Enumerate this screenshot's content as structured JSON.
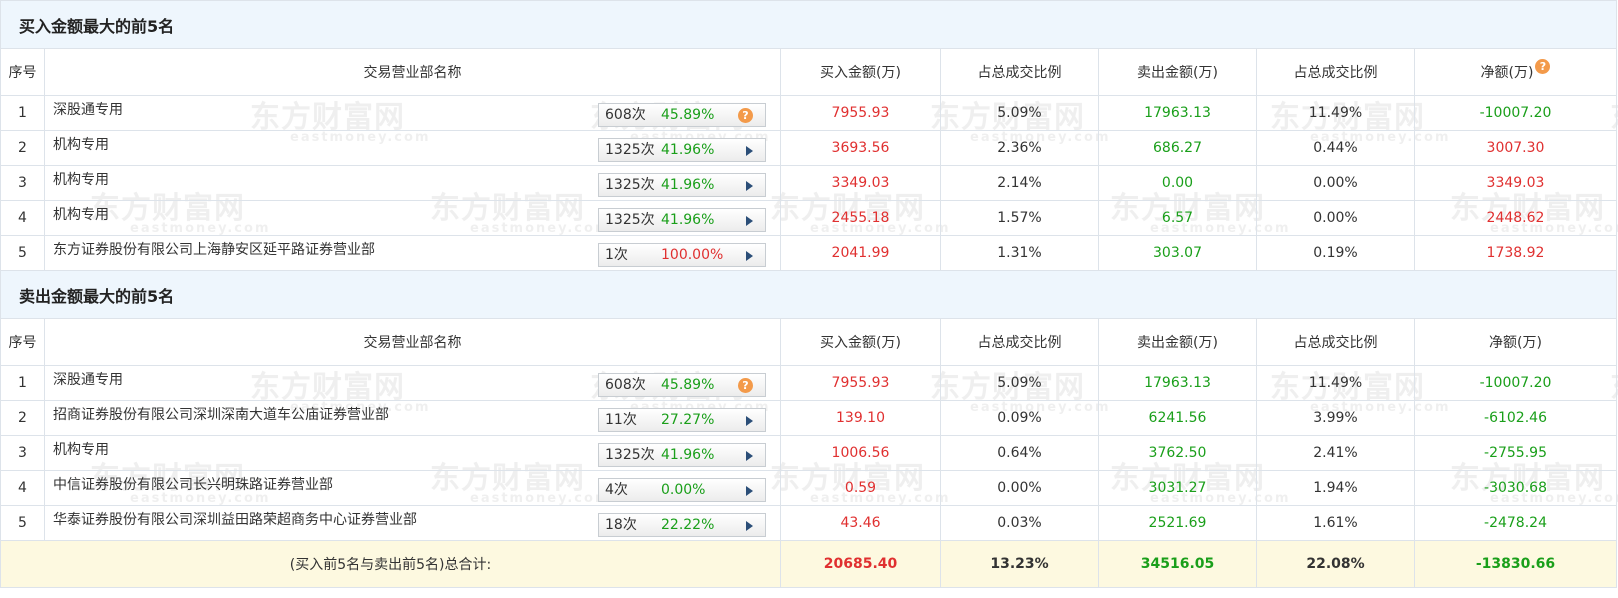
{
  "buy_section": {
    "title": "买入金额最大的前5名",
    "rows": [
      {
        "rank": "1",
        "name": "深股通专用",
        "count": "608次",
        "pct": "45.89%",
        "pct_color": "green",
        "button": "help",
        "buy": "7955.93",
        "buy_ratio": "5.09%",
        "sell": "17963.13",
        "sell_ratio": "11.49%",
        "net": "-10007.20",
        "net_color": "green"
      },
      {
        "rank": "2",
        "name": "机构专用",
        "count": "1325次",
        "pct": "41.96%",
        "pct_color": "green",
        "button": "arrow",
        "buy": "3693.56",
        "buy_ratio": "2.36%",
        "sell": "686.27",
        "sell_ratio": "0.44%",
        "net": "3007.30",
        "net_color": "red"
      },
      {
        "rank": "3",
        "name": "机构专用",
        "count": "1325次",
        "pct": "41.96%",
        "pct_color": "green",
        "button": "arrow",
        "buy": "3349.03",
        "buy_ratio": "2.14%",
        "sell": "0.00",
        "sell_ratio": "0.00%",
        "net": "3349.03",
        "net_color": "red"
      },
      {
        "rank": "4",
        "name": "机构专用",
        "count": "1325次",
        "pct": "41.96%",
        "pct_color": "green",
        "button": "arrow",
        "buy": "2455.18",
        "buy_ratio": "1.57%",
        "sell": "6.57",
        "sell_ratio": "0.00%",
        "net": "2448.62",
        "net_color": "red"
      },
      {
        "rank": "5",
        "name": "东方证券股份有限公司上海静安区延平路证券营业部",
        "count": "1次",
        "pct": "100.00%",
        "pct_color": "red",
        "button": "arrow",
        "buy": "2041.99",
        "buy_ratio": "1.31%",
        "sell": "303.07",
        "sell_ratio": "0.19%",
        "net": "1738.92",
        "net_color": "red"
      }
    ]
  },
  "sell_section": {
    "title": "卖出金额最大的前5名",
    "rows": [
      {
        "rank": "1",
        "name": "深股通专用",
        "count": "608次",
        "pct": "45.89%",
        "pct_color": "green",
        "button": "help",
        "buy": "7955.93",
        "buy_ratio": "5.09%",
        "sell": "17963.13",
        "sell_ratio": "11.49%",
        "net": "-10007.20",
        "net_color": "green"
      },
      {
        "rank": "2",
        "name": "招商证券股份有限公司深圳深南大道车公庙证券营业部",
        "count": "11次",
        "pct": "27.27%",
        "pct_color": "green",
        "button": "arrow",
        "buy": "139.10",
        "buy_ratio": "0.09%",
        "sell": "6241.56",
        "sell_ratio": "3.99%",
        "net": "-6102.46",
        "net_color": "green"
      },
      {
        "rank": "3",
        "name": "机构专用",
        "count": "1325次",
        "pct": "41.96%",
        "pct_color": "green",
        "button": "arrow",
        "buy": "1006.56",
        "buy_ratio": "0.64%",
        "sell": "3762.50",
        "sell_ratio": "2.41%",
        "net": "-2755.95",
        "net_color": "green"
      },
      {
        "rank": "4",
        "name": "中信证券股份有限公司长兴明珠路证券营业部",
        "count": "4次",
        "pct": "0.00%",
        "pct_color": "green",
        "button": "arrow",
        "buy": "0.59",
        "buy_ratio": "0.00%",
        "sell": "3031.27",
        "sell_ratio": "1.94%",
        "net": "-3030.68",
        "net_color": "green"
      },
      {
        "rank": "5",
        "name": "华泰证券股份有限公司深圳益田路荣超商务中心证券营业部",
        "count": "18次",
        "pct": "22.22%",
        "pct_color": "green",
        "button": "arrow",
        "buy": "43.46",
        "buy_ratio": "0.03%",
        "sell": "2521.69",
        "sell_ratio": "1.61%",
        "net": "-2478.24",
        "net_color": "green"
      }
    ]
  },
  "headers": {
    "rank": "序号",
    "name": "交易营业部名称",
    "buy": "买入金额(万)",
    "buy_ratio": "占总成交比例",
    "sell": "卖出金额(万)",
    "sell_ratio": "占总成交比例",
    "net": "净额(万)"
  },
  "help_glyph": "?",
  "total": {
    "label": "(买入前5名与卖出前5名)总合计:",
    "buy": "20685.40",
    "buy_ratio": "13.23%",
    "sell": "34516.05",
    "sell_ratio": "22.08%",
    "net": "-13830.66"
  },
  "watermark": {
    "text": "东方财富网",
    "sub": "eastmoney.com"
  },
  "colors": {
    "up": "#e03030",
    "down": "#1a9f1a",
    "section_bg": "#eef6fd",
    "total_bg": "#fdf9e0",
    "help_icon": "#f39a4a"
  }
}
